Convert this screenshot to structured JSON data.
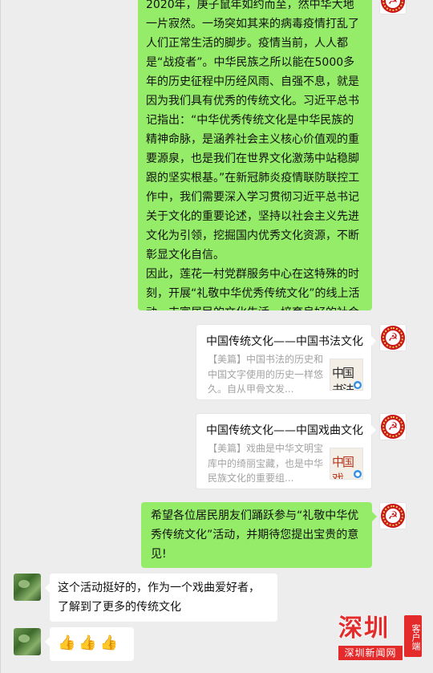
{
  "chat": {
    "long_message": {
      "paragraphs": [
        "2020年，庚子鼠年如约而至，然中华大地一片寂然。一场突如其来的病毒疫情打乱了人们正常生活的脚步。疫情当前，人人都是“战疫者”。中华民族之所以能在5000多年的历史征程中历经风雨、自强不息，就是因为我们具有优秀的传统文化。习近平总书记指出：“中华优秀传统文化是中华民族的精神命脉，是涵养社会主义核心价值观的重要源泉，也是我们在世界文化激荡中站稳脚跟的坚实根基。”在新冠肺炎疫情联防联控工作中，我们需要深入学习贯彻习近平总书记关于文化的重要论述，坚持以社会主义先进文化为引领，挖掘国内优秀文化资源，不断彰显文化自信。",
        "因此，莲花一村党群服务中心在这特殊的时刻，开展“礼敬中华优秀传统文化”的线上活动，丰富居民的文化生活，培育良好的社会风尚，增强居民的凝聚力，归属感，让居民更好传承中华优秀传统文化。"
      ]
    },
    "card_calligraphy": {
      "title": "中国传统文化——中国书法文化",
      "desc": "【美篇】中国书法的历史和中国文字使用的历史一样悠久。自从甲骨文发...",
      "thumb_text": "中国书法"
    },
    "card_opera": {
      "title": "中国传统文化——中国戏曲文化",
      "desc": "【美篇】戏曲是中华文明宝库中的绮丽宝藏，也是中华民族文化的重要组...",
      "thumb_text": "中国戏"
    },
    "hope_message": "希望各位居民朋友们踊跃参与“礼敬中华优秀传统文化”活动，并期待您提出宝贵的意见!",
    "reply_message": "这个活动挺好的，作为一个戏曲爱好者，了解到了更多的传统文化",
    "thumbs": [
      "👍",
      "👍",
      "👍"
    ]
  },
  "watermark": {
    "logo": "深圳",
    "client": "客户端",
    "name": "深圳新闻网"
  },
  "colors": {
    "self_bubble": "#95ec69",
    "other_bubble": "#ffffff",
    "background": "#ededed",
    "watermark_red": "#e32b2b"
  }
}
